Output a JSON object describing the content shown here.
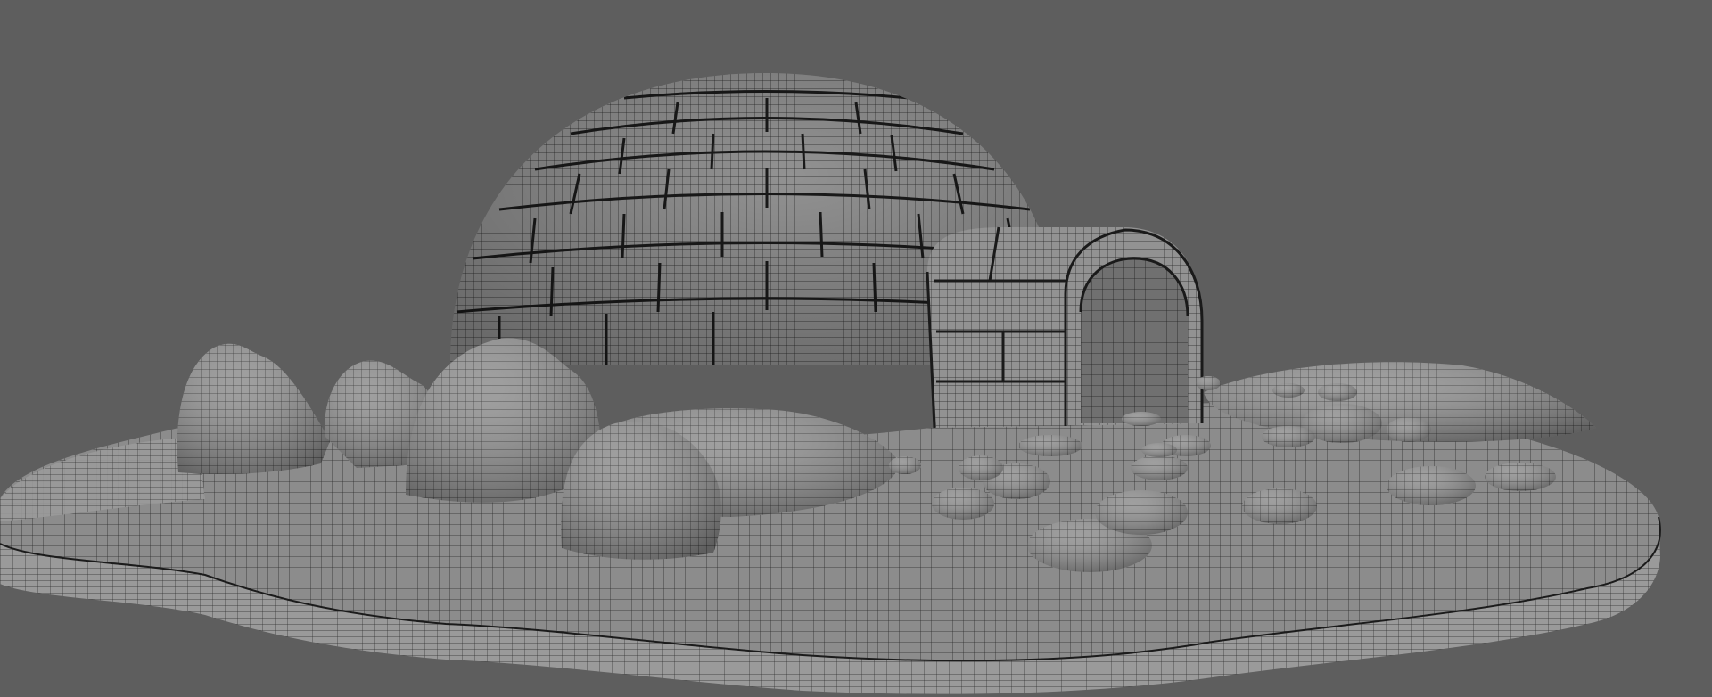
{
  "scene": {
    "background_color": "#5e5e5e",
    "mesh_fill_color": "#8f8f8f",
    "mesh_shadow_color": "#6f6f6f",
    "wire_color": "#1e1e1e",
    "objects": [
      "igloo-dome",
      "igloo-entrance-tunnel",
      "terrain-platform",
      "rock",
      "snow-mound"
    ]
  }
}
